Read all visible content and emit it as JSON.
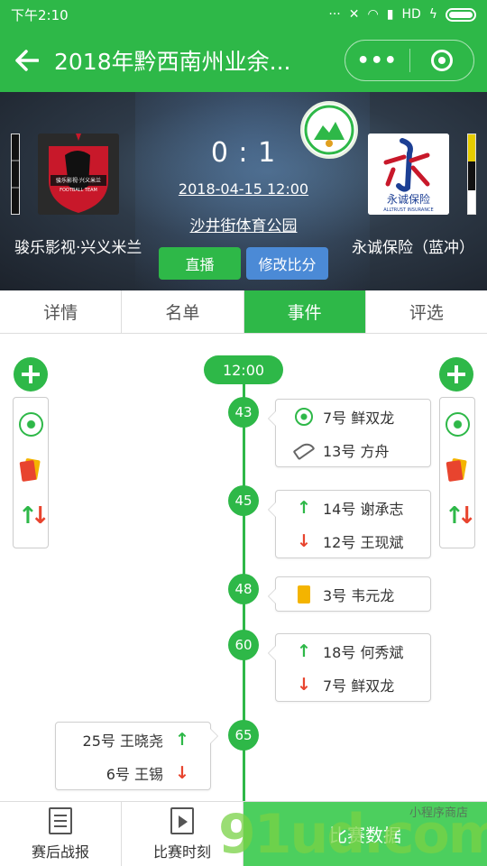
{
  "status_bar": {
    "time": "下午2:10",
    "network": "HD"
  },
  "app_bar": {
    "back_icon": "back-arrow-icon",
    "title": "2018年黔西南州业余...",
    "more_icon": "more-dots-icon",
    "close_icon": "close-circle-icon"
  },
  "match": {
    "home_team": "骏乐影视·兴义米兰",
    "away_team": "永诚保险（蓝冲）",
    "score": "0 : 1",
    "datetime": "2018-04-15 12:00",
    "venue": "沙井街体育公园",
    "live_label": "直播",
    "edit_score_label": "修改比分",
    "home_logo_text": "骏乐影视·兴义米兰",
    "home_logo_sub": "FOOTBALL TEAM",
    "away_logo_text": "永诚保险",
    "away_logo_sub": "ALLTRUST INSURANCE"
  },
  "tabs": [
    {
      "label": "详情",
      "active": false
    },
    {
      "label": "名单",
      "active": false
    },
    {
      "label": "事件",
      "active": true
    },
    {
      "label": "评选",
      "active": false
    }
  ],
  "timeline": {
    "start_time": "12:00",
    "events": [
      {
        "minute": "43",
        "side": "away",
        "rows": [
          {
            "icon": "goal-ball-icon",
            "text": "7号 鲜双龙"
          },
          {
            "icon": "assist-boot-icon",
            "text": "13号 方舟"
          }
        ]
      },
      {
        "minute": "45",
        "side": "away",
        "rows": [
          {
            "icon": "sub-in-arrow-icon",
            "text": "14号 谢承志"
          },
          {
            "icon": "sub-out-arrow-icon",
            "text": "12号 王现斌"
          }
        ]
      },
      {
        "minute": "48",
        "side": "away",
        "rows": [
          {
            "icon": "yellow-card-icon",
            "text": "3号 韦元龙"
          }
        ]
      },
      {
        "minute": "60",
        "side": "away",
        "rows": [
          {
            "icon": "sub-in-arrow-icon",
            "text": "18号 何秀斌"
          },
          {
            "icon": "sub-out-arrow-icon",
            "text": "7号 鲜双龙"
          }
        ]
      },
      {
        "minute": "65",
        "side": "home",
        "rows": [
          {
            "icon": "sub-in-arrow-icon",
            "text": "25号 王晓尧"
          },
          {
            "icon": "sub-out-arrow-icon",
            "text": "6号 王锡"
          }
        ]
      }
    ]
  },
  "bottom_bar": {
    "report_label": "赛后战报",
    "moments_label": "比赛时刻",
    "data_label": "比赛数据"
  },
  "watermark": {
    "main": "91ud.com",
    "sub": "小程序商店"
  },
  "colors": {
    "primary": "#2eb848",
    "blue_button": "#4b8ad6",
    "red": "#e8442e",
    "yellow": "#f4b400"
  }
}
